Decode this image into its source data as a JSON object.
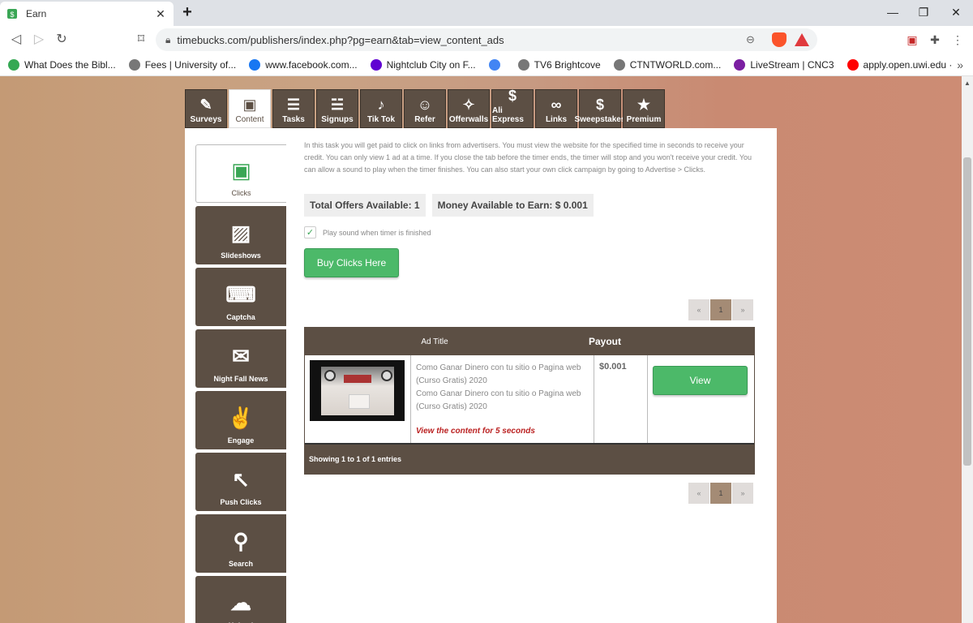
{
  "browser": {
    "tab_title": "Earn",
    "url": "timebucks.com/publishers/index.php?pg=earn&tab=view_content_ads",
    "bookmarks": [
      {
        "label": "What Does the Bibl...",
        "color": "#34a853"
      },
      {
        "label": "Fees | University of...",
        "color": "#777777"
      },
      {
        "label": "www.facebook.com...",
        "color": "#1877f2"
      },
      {
        "label": "Nightclub City on F...",
        "color": "#6001d2"
      },
      {
        "label": "",
        "color": "#4285f4"
      },
      {
        "label": "TV6 Brightcove",
        "color": "#777777"
      },
      {
        "label": "CTNTWORLD.com...",
        "color": "#777777"
      },
      {
        "label": "LiveStream | CNC3",
        "color": "#7b1fa2"
      },
      {
        "label": "apply.open.uwi.edu ·",
        "color": "#ff0000"
      }
    ]
  },
  "topnav": [
    {
      "label": "Surveys",
      "icon": "clipboard-pencil-icon",
      "glyph": "✎"
    },
    {
      "label": "Content",
      "icon": "content-ad-icon",
      "glyph": "▣"
    },
    {
      "label": "Tasks",
      "icon": "tasks-icon",
      "glyph": "☰"
    },
    {
      "label": "Signups",
      "icon": "signups-icon",
      "glyph": "☱"
    },
    {
      "label": "Tik Tok",
      "icon": "tiktok-icon",
      "glyph": "♪"
    },
    {
      "label": "Refer",
      "icon": "refer-people-icon",
      "glyph": "☺"
    },
    {
      "label": "Offerwalls",
      "icon": "share-icon",
      "glyph": "✧"
    },
    {
      "label": "Ali Express",
      "icon": "dollar-coin-icon",
      "glyph": "$"
    },
    {
      "label": "Links",
      "icon": "link-icon",
      "glyph": "∞"
    },
    {
      "label": "Sweepstakes",
      "icon": "money-bag-icon",
      "glyph": "$"
    },
    {
      "label": "Premium",
      "icon": "star-icon",
      "glyph": "★"
    }
  ],
  "sidenav": [
    {
      "label": "Clicks",
      "icon": "ad-screen-icon",
      "glyph": "▣"
    },
    {
      "label": "Slideshows",
      "icon": "slideshow-icon",
      "glyph": "▨"
    },
    {
      "label": "Captcha",
      "icon": "captcha-icon",
      "glyph": "⌨"
    },
    {
      "label": "Night Fall News",
      "icon": "ballot-box-icon",
      "glyph": "✉"
    },
    {
      "label": "Engage",
      "icon": "thumbs-up-chat-icon",
      "glyph": "✌"
    },
    {
      "label": "Push Clicks",
      "icon": "cursor-click-icon",
      "glyph": "↖"
    },
    {
      "label": "Search",
      "icon": "search-icon",
      "glyph": "⚲"
    },
    {
      "label": "Upload",
      "icon": "cloud-upload-icon",
      "glyph": "☁"
    }
  ],
  "content": {
    "description": "In this task you will get paid to click on links from advertisers. You must view the website for the specified time in seconds to receive your credit. You can only view 1 ad at a time. If you close the tab before the timer ends, the timer will stop and you won't receive your credit. You can allow a sound to play when the timer finishes. You can also start your own click campaign by going to Advertise > Clicks.",
    "total_offers": "Total Offers Available: 1",
    "money_available": "Money Available to Earn: $ 0.001",
    "play_sound_label": "Play sound when timer is finished",
    "play_sound_checked": true,
    "buy_clicks_label": "Buy Clicks Here",
    "pager": {
      "prev": "«",
      "current": "1",
      "next": "»"
    },
    "table": {
      "col_title": "Ad Title",
      "col_payout": "Payout",
      "rows": [
        {
          "title_line1": "Como Ganar Dinero con tu sitio o Pagina web (Curso Gratis) 2020",
          "title_line2": "Como Ganar Dinero con tu sitio o Pagina web (Curso Gratis) 2020",
          "timer_text": "View the content for 5 seconds",
          "payout": "$0.001",
          "action": "View"
        }
      ],
      "footer": "Showing 1 to 1 of 1 entries"
    }
  },
  "colors": {
    "brown": "#5c4f44",
    "green": "#4cb969",
    "timer_red": "#b22222"
  }
}
